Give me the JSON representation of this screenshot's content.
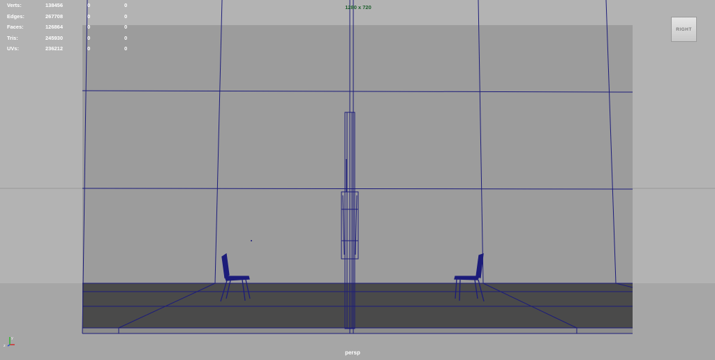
{
  "hud": {
    "rows": [
      {
        "label": "Verts:",
        "total": "138456",
        "selected": "0",
        "component": "0"
      },
      {
        "label": "Edges:",
        "total": "267708",
        "selected": "0",
        "component": "0"
      },
      {
        "label": "Faces:",
        "total": "126864",
        "selected": "0",
        "component": "0"
      },
      {
        "label": "Tris:",
        "total": "245930",
        "selected": "0",
        "component": "0"
      },
      {
        "label": "UVs:",
        "total": "236212",
        "selected": "0",
        "component": "0"
      }
    ]
  },
  "resolution_gate": "1280 x 720",
  "camera": "persp",
  "viewcube_face": "RIGHT",
  "axis_labels": {
    "x": "x",
    "y": "y"
  },
  "colors": {
    "wireframe": "#1c1c7a",
    "background": "#b3b3b3",
    "gate_bg": "#9c9c9c",
    "floor": "#4a4a4a",
    "hud_text": "#ffffff",
    "resolution_text": "#1b5e2a",
    "axis_x": "#d12b2b",
    "axis_y": "#2fb52f",
    "axis_z": "#2b56d1"
  },
  "icons": [
    "viewcube-icon",
    "axis-gizmo-icon"
  ]
}
